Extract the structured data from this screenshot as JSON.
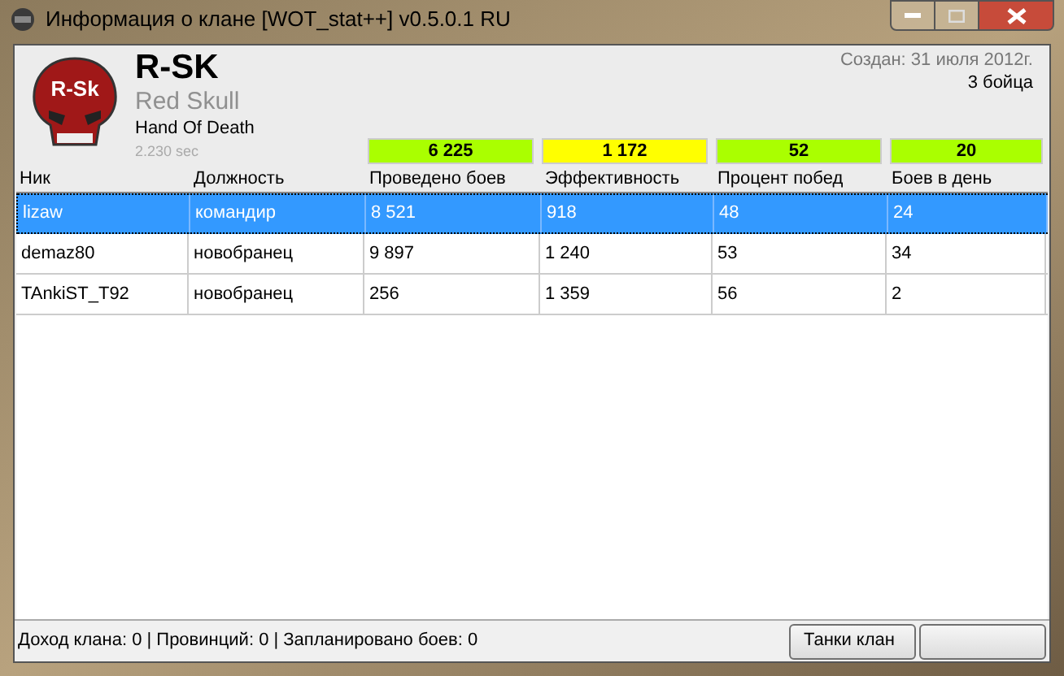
{
  "window": {
    "title": "Информация о клане [WOT_stat++] v0.5.0.1 RU"
  },
  "clan": {
    "logo_text": "R-Sk",
    "tag": "R-SK",
    "name": "Red Skull",
    "motto": "Hand Of Death",
    "load_time": "2.230 sec",
    "created": "Создан: 31 июля 2012г.",
    "members": "3 бойца"
  },
  "stats": [
    {
      "value": "6 225",
      "color": "#aaff00"
    },
    {
      "value": "1 172",
      "color": "#ffff00"
    },
    {
      "value": "52",
      "color": "#aaff00"
    },
    {
      "value": "20",
      "color": "#aaff00"
    }
  ],
  "table": {
    "columns": [
      "Ник",
      "Должность",
      "Проведено боев",
      "Эффективность",
      "Процент побед",
      "Боев в день"
    ],
    "rows": [
      {
        "cells": [
          "lizaw",
          "командир",
          "8 521",
          "918",
          "48",
          "24"
        ],
        "selected": true
      },
      {
        "cells": [
          "demaz80",
          "новобранец",
          "9 897",
          "1 240",
          "53",
          "34"
        ],
        "selected": false
      },
      {
        "cells": [
          "TAnkiST_T92",
          "новобранец",
          "256",
          "1 359",
          "56",
          "2"
        ],
        "selected": false
      }
    ]
  },
  "status_bar": {
    "text": "Доход клана: 0 | Провинций: 0 | Запланировано боев: 0",
    "buttons": [
      "Танки клан"
    ]
  }
}
